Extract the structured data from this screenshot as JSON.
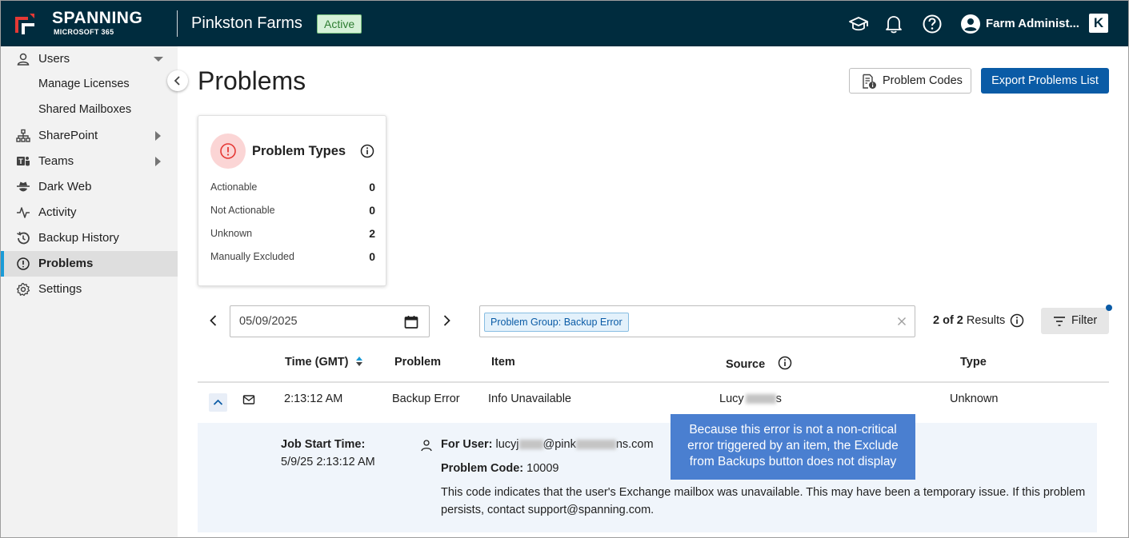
{
  "header": {
    "brand": "SPANNING",
    "brand_sub": "MICROSOFT 365",
    "tenant": "Pinkston Farms",
    "status": "Active",
    "user_name": "Farm Administ...",
    "k_logo": "K",
    "icons": [
      "graduation-cap-icon",
      "bell-icon",
      "help-icon",
      "user-avatar-icon"
    ],
    "colors": {
      "bg": "#002c3e",
      "status_bg": "#d6f1d8",
      "status_fg": "#2e7d32"
    }
  },
  "sidebar": {
    "items": [
      {
        "label": "Users",
        "icon": "user-icon",
        "expand": "down"
      },
      {
        "label": "Manage Licenses",
        "sub": true
      },
      {
        "label": "Shared Mailboxes",
        "sub": true
      },
      {
        "label": "SharePoint",
        "icon": "sitemap-icon",
        "expand": "right"
      },
      {
        "label": "Teams",
        "icon": "teams-icon",
        "expand": "right"
      },
      {
        "label": "Dark Web",
        "icon": "spy-icon"
      },
      {
        "label": "Activity",
        "icon": "pulse-icon"
      },
      {
        "label": "Backup History",
        "icon": "history-icon"
      },
      {
        "label": "Problems",
        "icon": "alert-circle-icon",
        "active": true
      },
      {
        "label": "Settings",
        "icon": "gear-icon"
      }
    ],
    "active_color": "#1a9bd7"
  },
  "page": {
    "title": "Problems",
    "problem_codes_label": "Problem Codes",
    "export_label": "Export Problems List"
  },
  "problem_types": {
    "title": "Problem Types",
    "rows": [
      {
        "label": "Actionable",
        "value": "0"
      },
      {
        "label": "Not Actionable",
        "value": "0"
      },
      {
        "label": "Unknown",
        "value": "2"
      },
      {
        "label": "Manually Excluded",
        "value": "0"
      }
    ]
  },
  "toolbar": {
    "date": "05/09/2025",
    "filter_chip": "Problem Group: Backup Error",
    "results_count": "2 of 2",
    "results_label": "Results",
    "filter_label": "Filter"
  },
  "table": {
    "columns": [
      "Time (GMT)",
      "Problem",
      "Item",
      "Source",
      "Type"
    ],
    "rows": [
      {
        "time": "2:13:12 AM",
        "problem": "Backup Error",
        "item": "Info Unavailable",
        "source_start": "Lucy",
        "source_end": "s",
        "type": "Unknown"
      }
    ]
  },
  "detail": {
    "job_start_label": "Job Start Time:",
    "job_start_value": "5/9/25 2:13:12 AM",
    "for_user_label": "For User:",
    "email_start": "lucyj",
    "email_mid": "@pink",
    "email_end": "ns.com",
    "problem_code_label": "Problem Code:",
    "problem_code_value": "10009",
    "description_line1": "This code indicates that the user's Exchange mailbox was unavailable. This may have been a temporary issue. If this problem",
    "description_line2": "persists, contact support@spanning.com."
  },
  "callout": {
    "line1": "Because this error is not a non-critical",
    "line2": "error triggered by an item, the Exclude",
    "line3": "from Backups button does not display",
    "color": "#4a7fd0"
  }
}
